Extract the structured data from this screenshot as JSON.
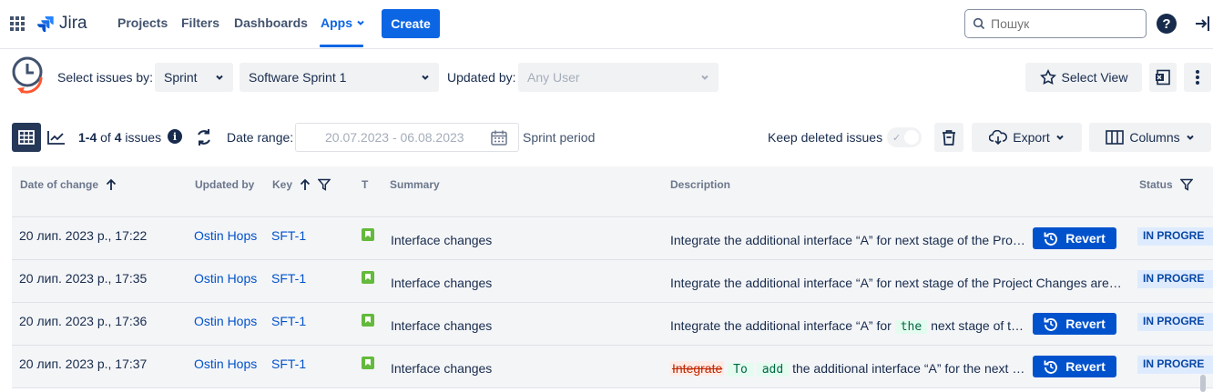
{
  "nav": {
    "logo": "Jira",
    "items": [
      "Projects",
      "Filters",
      "Dashboards",
      "Apps"
    ],
    "create": "Create",
    "search_placeholder": "Пошук"
  },
  "filters": {
    "select_by_label": "Select issues by:",
    "select_by_value": "Sprint",
    "sprint_value": "Software Sprint 1",
    "updated_by_label": "Updated by:",
    "updated_by_value": "Any User",
    "select_view": "Select View"
  },
  "toolbar": {
    "count_range": "1-4",
    "count_of": "of",
    "count_total": "4",
    "count_suffix": "issues",
    "date_range_label": "Date range:",
    "date_range_value": "20.07.2023 - 06.08.2023",
    "sprint_period": "Sprint period",
    "keep_deleted": "Keep deleted issues",
    "export": "Export",
    "columns": "Columns"
  },
  "table": {
    "headers": {
      "date": "Date of change",
      "updated_by": "Updated by",
      "key": "Key",
      "type": "T",
      "summary": "Summary",
      "description": "Description",
      "status": "Status"
    },
    "revert_label": "Revert",
    "rows": [
      {
        "date": "20 лип. 2023 р., 17:22",
        "user": "Ostin Hops",
        "key": "SFT-1",
        "summary": "Interface changes",
        "desc": "Integrate the additional interface “A” for next stage of the Proj...",
        "status": "IN PROGRE"
      },
      {
        "date": "20 лип. 2023 р., 17:35",
        "user": "Ostin Hops",
        "key": "SFT-1",
        "summary": "Interface changes",
        "desc": "Integrate the additional interface “A” for next stage of the Project Changes are ...",
        "status": "IN PROGRE"
      },
      {
        "date": "20 лип. 2023 р., 17:36",
        "user": "Ostin Hops",
        "key": "SFT-1",
        "summary": "Interface changes",
        "desc_a": "Integrate the additional interface “A” for",
        "desc_ins": "the",
        "desc_b": "next stage of th...",
        "status": "IN PROGRE"
      },
      {
        "date": "20 лип. 2023 р., 17:37",
        "user": "Ostin Hops",
        "key": "SFT-1",
        "summary": "Interface changes",
        "desc_del": "Integrate",
        "desc_ins1": "To",
        "desc_ins2": "add",
        "desc_b": "the additional interface “A” for the next s...",
        "status": "IN PROGRE"
      }
    ]
  },
  "colors": {
    "brand": "#0c66e4",
    "status_bg": "#deebff",
    "story": "#63ba3c"
  }
}
